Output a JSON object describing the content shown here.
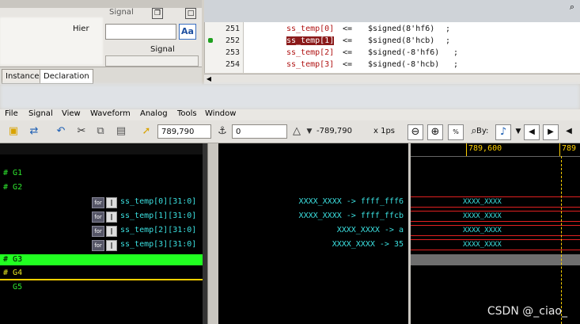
{
  "top_left": {
    "signal_title": "Signal",
    "hier_label": "Hier",
    "signal_label": "Signal",
    "aa_label": "Aa",
    "tabs": [
      "Instance",
      "Declaration"
    ]
  },
  "source": {
    "lines": [
      {
        "num": "251",
        "lhs": "ss_temp[0]",
        "op": "<=",
        "rhs": "$signed(8'hf6)",
        "end": ";"
      },
      {
        "num": "252",
        "lhs": "ss_temp[1]",
        "op": "<=",
        "rhs": "$signed(8'hcb)",
        "end": ";"
      },
      {
        "num": "253",
        "lhs": "ss_temp[2]",
        "op": "<=",
        "rhs": "$signed(-8'hf6)",
        "end": ";"
      },
      {
        "num": "254",
        "lhs": "ss_temp[3]",
        "op": "<=",
        "rhs": "$signed(-8'hcb)",
        "end": ";"
      }
    ]
  },
  "menu": [
    "File",
    "Signal",
    "View",
    "Waveform",
    "Analog",
    "Tools",
    "Window"
  ],
  "toolbar": {
    "cursor_time": "789,790",
    "marker_time": "0",
    "delta": "-789,790",
    "scale": "x 1ps",
    "by_label": "By:"
  },
  "groups": [
    "G1",
    "G2",
    "G3",
    "G4",
    "G5"
  ],
  "signals": [
    {
      "name": "ss_temp[0][31:0]",
      "value": "XXXX_XXXX -> ffff_fff6",
      "wave": "XXXX_XXXX"
    },
    {
      "name": "ss_temp[1][31:0]",
      "value": "XXXX_XXXX -> ffff_ffcb",
      "wave": "XXXX_XXXX"
    },
    {
      "name": "ss_temp[2][31:0]",
      "value": "XXXX_XXXX -> a",
      "wave": "XXXX_XXXX"
    },
    {
      "name": "ss_temp[3][31:0]",
      "value": "XXXX_XXXX -> 35",
      "wave": "XXXX_XXXX"
    }
  ],
  "ruler": {
    "label1": "789,600",
    "label2": "789"
  },
  "watermark": "CSDN @_ciao_",
  "colors": {
    "group": "#2ee62e",
    "signal": "#3be0e0",
    "selected_bg": "#21ff21",
    "bus": "#e02020",
    "cursor": "#ffd000"
  }
}
